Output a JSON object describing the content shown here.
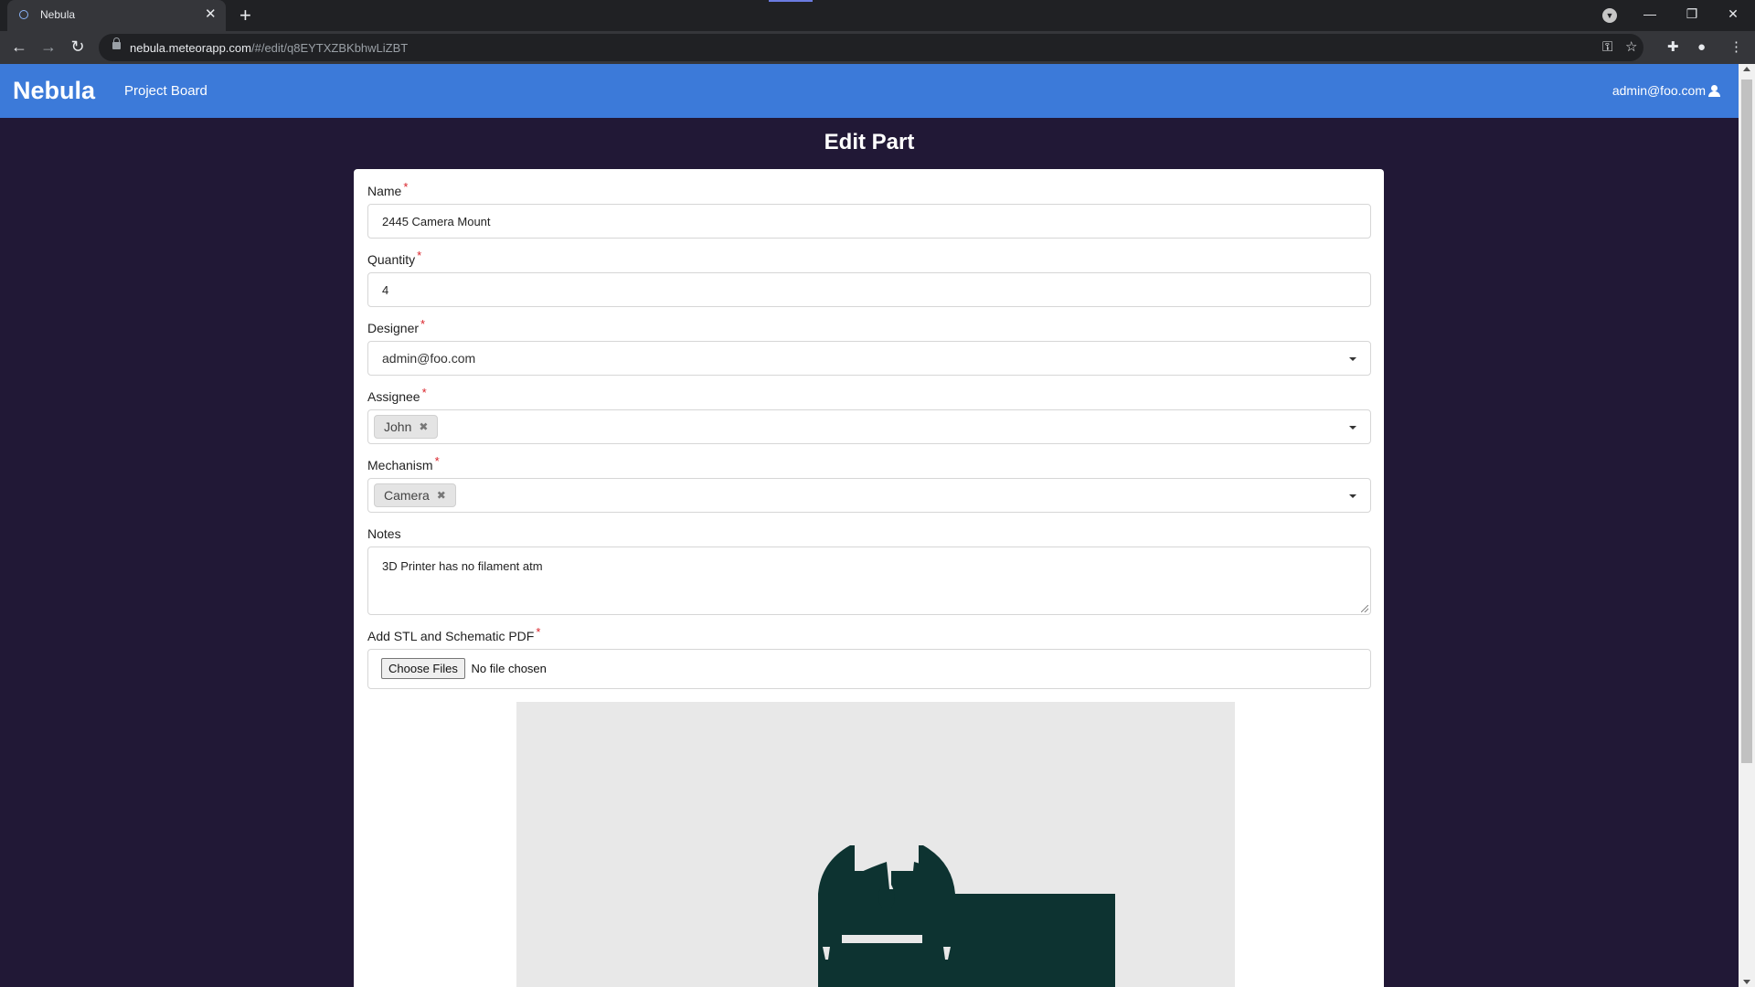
{
  "browser": {
    "tab_title": "Nebula",
    "url_host": "nebula.meteorapp.com",
    "url_path": "/#/edit/q8EYTXZBKbhwLiZBT"
  },
  "navbar": {
    "brand": "Nebula",
    "links": [
      "Project Board"
    ],
    "user": "admin@foo.com"
  },
  "page": {
    "title": "Edit Part"
  },
  "form": {
    "name": {
      "label": "Name",
      "value": "2445 Camera Mount"
    },
    "quantity": {
      "label": "Quantity",
      "value": "4"
    },
    "designer": {
      "label": "Designer",
      "value": "admin@foo.com"
    },
    "assignee": {
      "label": "Assignee",
      "chips": [
        "John"
      ]
    },
    "mechanism": {
      "label": "Mechanism",
      "chips": [
        "Camera"
      ]
    },
    "notes": {
      "label": "Notes",
      "value": "3D Printer has no filament atm"
    },
    "files": {
      "label": "Add STL and Schematic PDF",
      "button": "Choose Files",
      "status": "No file chosen"
    },
    "required_marker": "*"
  },
  "colors": {
    "navbar": "#3c7ad9",
    "background": "#211836",
    "required": "#d9232a",
    "preview_shape": "#0d3331"
  },
  "icons": {
    "user": "user-icon",
    "chip_remove": "close-icon",
    "dropdown": "caret-down-icon"
  }
}
